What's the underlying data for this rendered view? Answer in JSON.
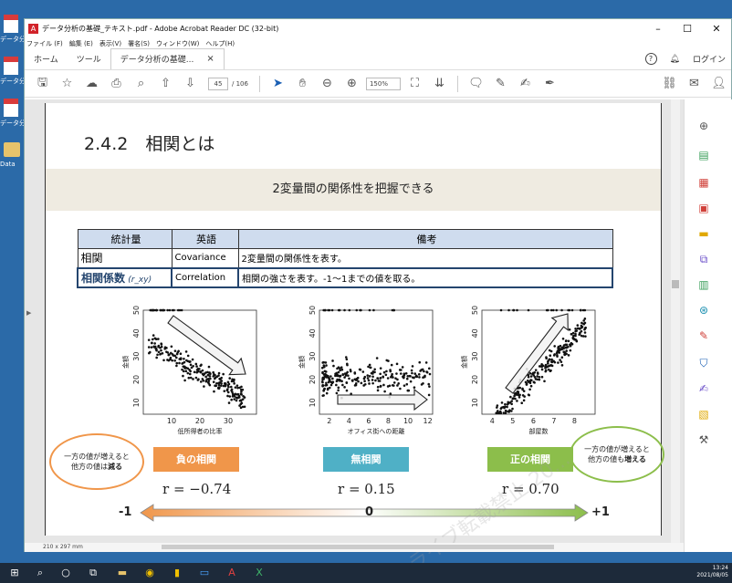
{
  "desktop": {
    "icons": [
      {
        "label": "データ分析",
        "kind": "pdf",
        "top": 14
      },
      {
        "label": "データ分析",
        "kind": "pdf",
        "top": 60
      },
      {
        "label": "データ分析",
        "kind": "pdf",
        "top": 106
      },
      {
        "label": "Data",
        "kind": "folder",
        "top": 152
      }
    ]
  },
  "window": {
    "title": "データ分析の基礎_テキスト.pdf - Adobe Acrobat Reader DC (32-bit)",
    "menu": [
      "ファイル (F)",
      "編集 (E)",
      "表示(V)",
      "署名(S)",
      "ウィンドウ(W)",
      "ヘルプ(H)"
    ],
    "tabs": {
      "home": "ホーム",
      "tools": "ツール",
      "doc": "データ分析の基礎..."
    },
    "login": "ログイン",
    "page_current": "45",
    "page_total": "/ 106",
    "zoom": "150%",
    "status_size": "210 x 297 mm"
  },
  "slide": {
    "heading": "2.4.2　相関とは",
    "banner": "2変量間の関係性を把握できる",
    "table": {
      "headers": [
        "統計量",
        "英語",
        "備考"
      ],
      "rows": [
        {
          "stat": "相関",
          "en": "Covariance",
          "note": "2変量間の関係性を表す。"
        },
        {
          "stat": "相関係数",
          "stat_sub": "(r_xy)",
          "en": "Correlation",
          "note": "相関の強さを表す。-1〜1までの値を取る。"
        }
      ]
    },
    "bubble_left": {
      "line1": "一方の値が増えると",
      "line2": "他方の値は",
      "strong": "減る"
    },
    "bubble_right": {
      "line1": "一方の値が増えると",
      "line2": "他方の値も",
      "strong": "増える"
    },
    "badges": {
      "neg": "負の相関",
      "none": "無相関",
      "pos": "正の相関"
    },
    "rvals": {
      "neg": "r = −0.74",
      "none": "r = 0.15",
      "pos": "r = 0.70"
    },
    "scale": {
      "min": "-1",
      "mid": "0",
      "max": "+1"
    },
    "watermark": "ライブ転載禁止 20..."
  },
  "chart_data": [
    {
      "type": "scatter",
      "xlabel": "低所得者の比率",
      "ylabel": "金額",
      "xlim": [
        0,
        40
      ],
      "ylim": [
        5,
        50
      ],
      "xticks": [
        10,
        20,
        30
      ],
      "yticks": [
        10,
        20,
        30,
        40,
        50
      ],
      "trend": "down"
    },
    {
      "type": "scatter",
      "xlabel": "オフィス街への距離",
      "ylabel": "金額",
      "xlim": [
        1,
        12.5
      ],
      "ylim": [
        5,
        50
      ],
      "xticks": [
        2,
        4,
        6,
        8,
        10,
        12
      ],
      "yticks": [
        10,
        20,
        30,
        40,
        50
      ],
      "trend": "flat"
    },
    {
      "type": "scatter",
      "xlabel": "部屋数",
      "ylabel": "金額",
      "xlim": [
        3.5,
        9
      ],
      "ylim": [
        5,
        50
      ],
      "xticks": [
        4,
        5,
        6,
        7,
        8
      ],
      "yticks": [
        10,
        20,
        30,
        40,
        50
      ],
      "trend": "up"
    }
  ],
  "taskbar": {
    "time": "13:24",
    "date": "2021/08/05"
  },
  "colors": {
    "neg": "#f0964a",
    "none": "#4fb0c6",
    "pos": "#8cbe4b",
    "header_bg": "#cfdcee",
    "accent": "#24456e"
  }
}
